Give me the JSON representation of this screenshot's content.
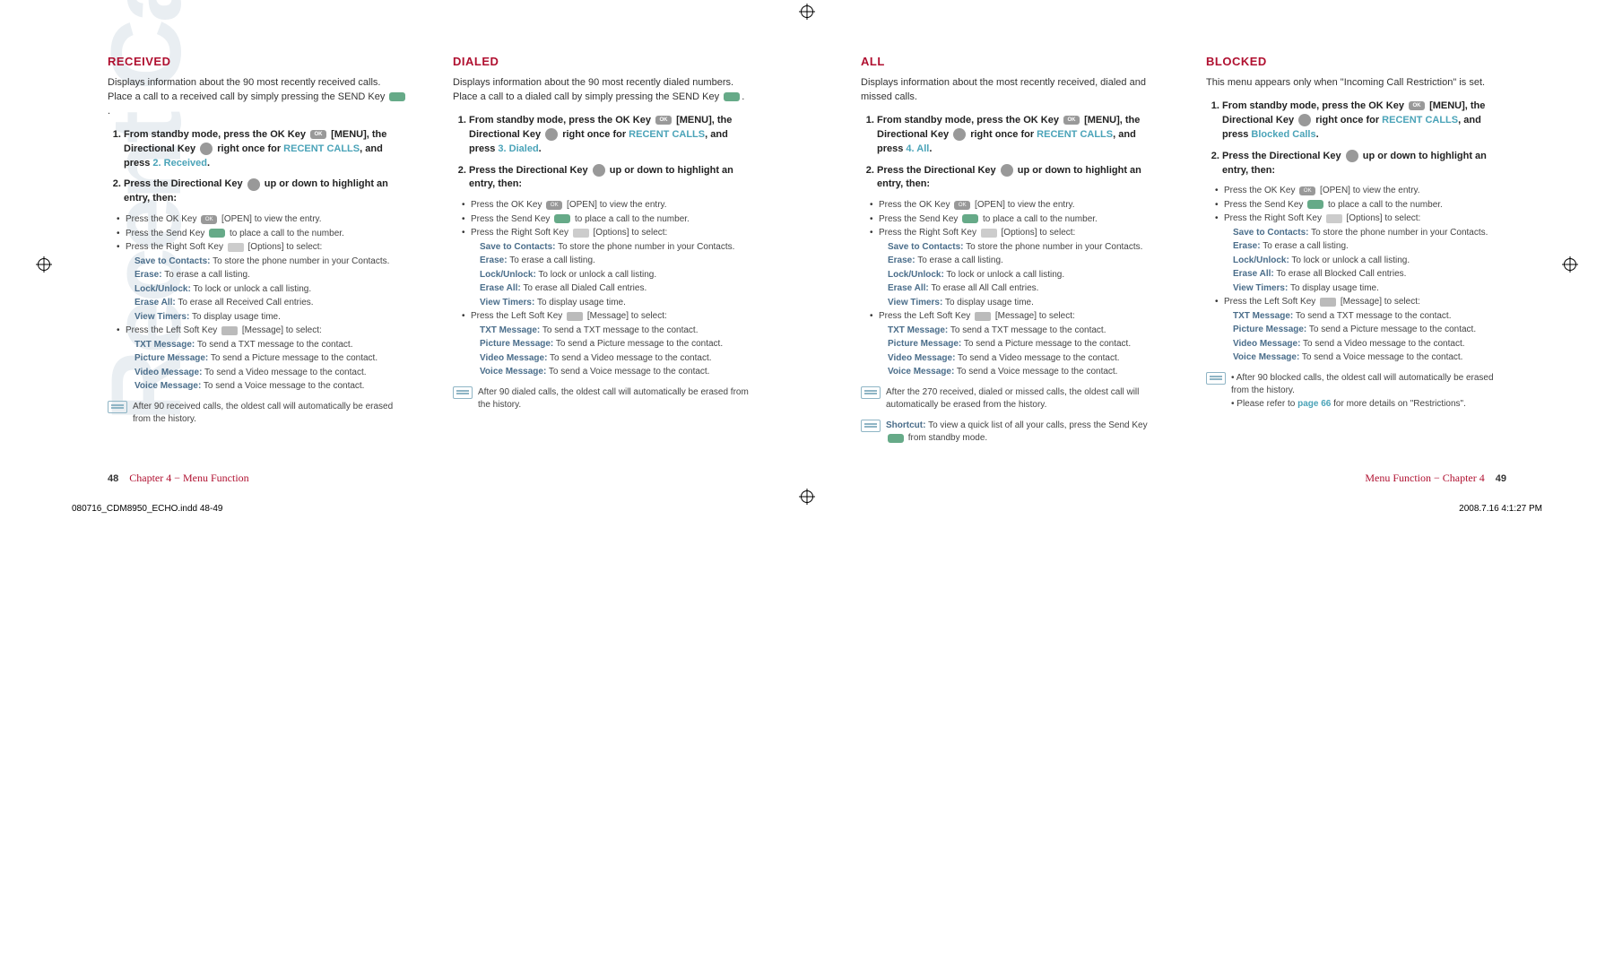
{
  "watermark": "Recent Calls",
  "sections": {
    "received": {
      "title": "RECEIVED",
      "desc": "Displays information about the 90 most recently received calls. Place a call to a received call by simply pressing the SEND Key",
      "step1_a": "From standby mode, press the OK Key",
      "step1_b": "[MENU], the Directional Key",
      "step1_c": "right once for",
      "step1_link": "RECENT CALLS",
      "step1_d": ", and press",
      "step1_end": "2. Received",
      "step2": "Press the Directional Key",
      "step2_b": "up or down to highlight an entry, then:",
      "b_ok": "Press the OK Key",
      "b_ok2": "[OPEN] to view the entry.",
      "b_send": "Press the Send Key",
      "b_send2": "to place a call to the number.",
      "b_rsoft": "Press the Right Soft Key",
      "b_rsoft2": "[Options] to select:",
      "opt_save_l": "Save to Contacts:",
      "opt_save_t": "To store the phone number in your Contacts.",
      "opt_erase_l": "Erase:",
      "opt_erase_t": "To erase a call listing.",
      "opt_lock_l": "Lock/Unlock:",
      "opt_lock_t": "To lock or unlock a call listing.",
      "opt_eraseall_l": "Erase All:",
      "opt_eraseall_t": "To erase all Received Call entries.",
      "opt_vt_l": "View Timers:",
      "opt_vt_t": "To display usage time.",
      "b_lsoft": "Press the Left Soft Key",
      "b_lsoft2": "[Message] to select:",
      "opt_txt_l": "TXT Message:",
      "opt_txt_t": "To send a TXT message to the contact.",
      "opt_pic_l": "Picture Message:",
      "opt_pic_t": "To send a Picture message to the contact.",
      "opt_vid_l": "Video Message:",
      "opt_vid_t": "To send a Video message to the contact.",
      "opt_voice_l": "Voice Message:",
      "opt_voice_t": "To send a Voice message to the contact.",
      "note": "After 90 received calls, the oldest call will automatically be erased from the history."
    },
    "dialed": {
      "title": "DIALED",
      "desc": "Displays information about the 90 most recently dialed numbers. Place a call to a dialed call by simply pressing the SEND Key",
      "step1_end": "3. Dialed",
      "opt_eraseall_t": "To erase all Dialed Call entries.",
      "note": "After 90 dialed calls, the oldest call will automatically be erased from the history."
    },
    "all": {
      "title": "ALL",
      "desc": "Displays information about the most recently received, dialed and missed calls.",
      "step1_end": "4. All",
      "opt_eraseall_t": "To erase all All Call entries.",
      "note1": "After the 270 received, dialed or missed calls, the oldest call will automatically be erased from the history.",
      "note2_l": "Shortcut:",
      "note2_t": "To view a quick list of all your calls, press the Send Key",
      "note2_t2": "from standby mode."
    },
    "blocked": {
      "title": "BLOCKED",
      "desc": "This menu appears only when \"Incoming Call Restriction\" is set.",
      "step1_end": "Blocked Calls",
      "opt_eraseall_t": "To erase all Blocked Call entries.",
      "note_a": "After 90 blocked calls, the oldest call will automatically be erased from the history.",
      "note_b1": "Please refer to",
      "note_b_link": "page 66",
      "note_b2": "for more details on \"Restrictions\"."
    }
  },
  "footer": {
    "left_num": "48",
    "left_chap": "Chapter 4 − Menu Function",
    "right_chap": "Menu Function − Chapter 4",
    "right_num": "49"
  },
  "trim": {
    "file": "080716_CDM8950_ECHO.indd   48-49",
    "date": "2008.7.16   4:1:27 PM"
  }
}
